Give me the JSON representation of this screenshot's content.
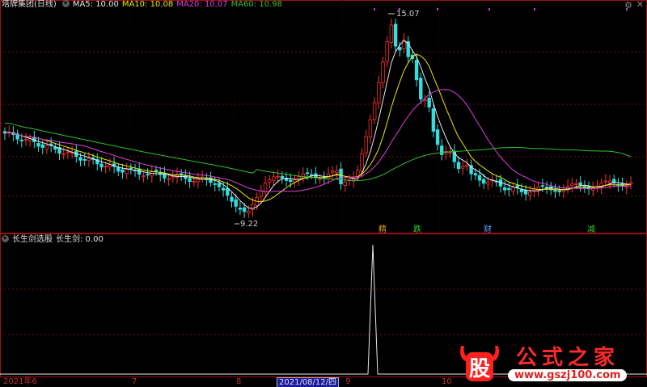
{
  "main_panel": {
    "title": "塔牌集团(日线)",
    "ma": [
      {
        "label": "MA5: 10.00",
        "color": "#e8e8e8"
      },
      {
        "label": "MA10: 10.08",
        "color": "#e8e800"
      },
      {
        "label": "MA20: 10.07",
        "color": "#e040e0"
      },
      {
        "label": "MA60: 10.98",
        "color": "#30c030"
      }
    ],
    "high_label": "15.07",
    "low_label": "9.22",
    "signals": [
      {
        "text": "精",
        "color": "#e0a020"
      },
      {
        "text": "跌",
        "color": "#30d030"
      },
      {
        "text": "财",
        "color": "#60a0ff"
      },
      {
        "text": "减",
        "color": "#30d030"
      }
    ]
  },
  "sub_panel": {
    "title": "长生剑选股",
    "value_label": "长生剑: 0.00"
  },
  "x_axis": {
    "labels": [
      "2021年6",
      "7",
      "8",
      "2021/08/12/四",
      "9",
      "10"
    ]
  },
  "logo": {
    "gu": "股",
    "text": "公式之家",
    "url": "www.gszj100.com"
  },
  "chart_data": {
    "type": "candlestick",
    "series": [
      {
        "name": "MA5",
        "color": "#e8e8e8"
      },
      {
        "name": "MA10",
        "color": "#e8e800"
      },
      {
        "name": "MA20",
        "color": "#e040e0"
      },
      {
        "name": "MA60",
        "color": "#30c030"
      }
    ],
    "price_range": [
      9.22,
      15.07
    ],
    "x_categories": [
      "2021年6",
      "7",
      "8",
      "9",
      "10"
    ],
    "indicator": {
      "name": "长生剑",
      "last_value": 0.0,
      "peak_date": "2021/08/12"
    }
  }
}
